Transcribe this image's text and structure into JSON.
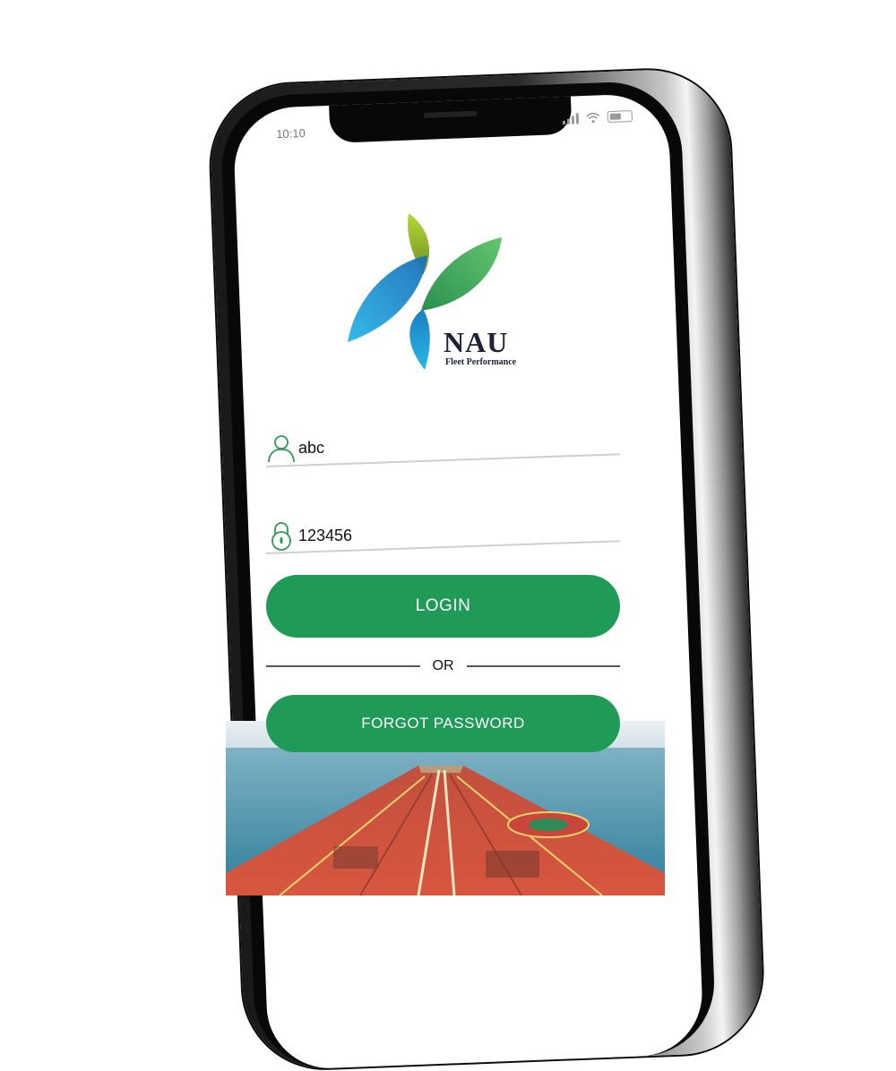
{
  "status_bar": {
    "time": "10:10"
  },
  "brand": {
    "name": "NAU",
    "subtitle": "Fleet Performance"
  },
  "login_form": {
    "username_value": "abc",
    "password_value": "123456",
    "login_label": "LOGIN",
    "or_label": "OR",
    "forgot_label": "FORGOT PASSWORD"
  },
  "colors": {
    "accent": "#1f9a57",
    "logo_blue": "#1fa3d8",
    "logo_green": "#3aa54a",
    "logo_lime": "#9cc42a"
  },
  "icons": [
    "user-icon",
    "lock-icon",
    "signal-icon",
    "wifi-icon",
    "battery-icon"
  ]
}
